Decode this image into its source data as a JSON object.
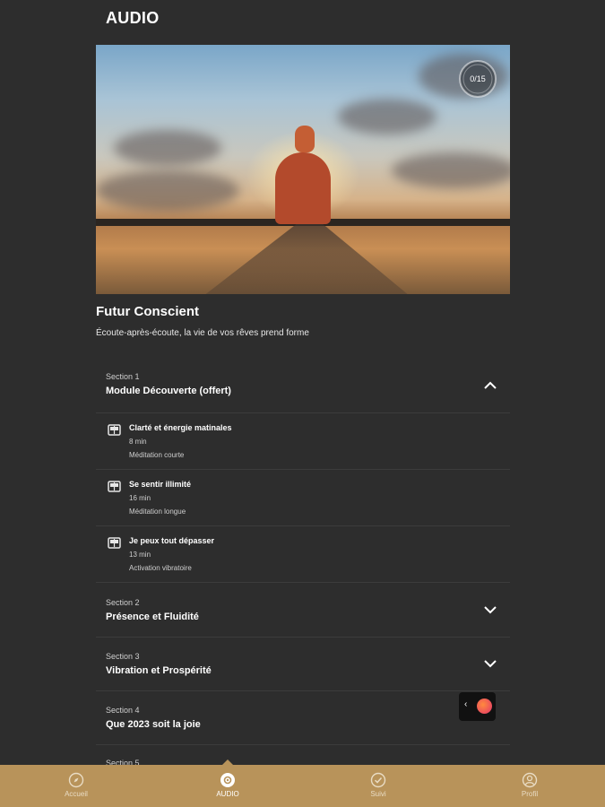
{
  "header": {
    "title": "AUDIO"
  },
  "hero": {
    "progress_label": "0/15",
    "progress_fraction": 0.0
  },
  "course": {
    "title": "Futur Conscient",
    "subtitle": "Écoute-après-écoute, la vie de vos rêves prend forme"
  },
  "sections": [
    {
      "label": "Section 1",
      "title": "Module Découverte (offert)",
      "expanded": true,
      "lessons": [
        {
          "title": "Clarté et énergie matinales",
          "duration": "8 min",
          "type": "Méditation courte"
        },
        {
          "title": "Se sentir illimité",
          "duration": "16 min",
          "type": "Méditation longue"
        },
        {
          "title": "Je peux tout dépasser",
          "duration": "13 min",
          "type": "Activation vibratoire"
        }
      ]
    },
    {
      "label": "Section 2",
      "title": "Présence et Fluidité",
      "expanded": false
    },
    {
      "label": "Section 3",
      "title": "Vibration et Prospérité",
      "expanded": false
    },
    {
      "label": "Section 4",
      "title": "Que 2023 soit la joie",
      "expanded": false
    },
    {
      "label": "Section 5",
      "title": "",
      "expanded": false
    }
  ],
  "bottom_nav": [
    {
      "label": "Accueil",
      "icon": "compass-icon",
      "active": false
    },
    {
      "label": "AUDIO",
      "icon": "audio-icon",
      "active": true
    },
    {
      "label": "Suivi",
      "icon": "check-circle-icon",
      "active": false
    },
    {
      "label": "Profil",
      "icon": "user-icon",
      "active": false
    }
  ],
  "colors": {
    "background": "#2d2d2d",
    "nav_bar": "#b8935a",
    "divider": "#3c3c3c"
  }
}
